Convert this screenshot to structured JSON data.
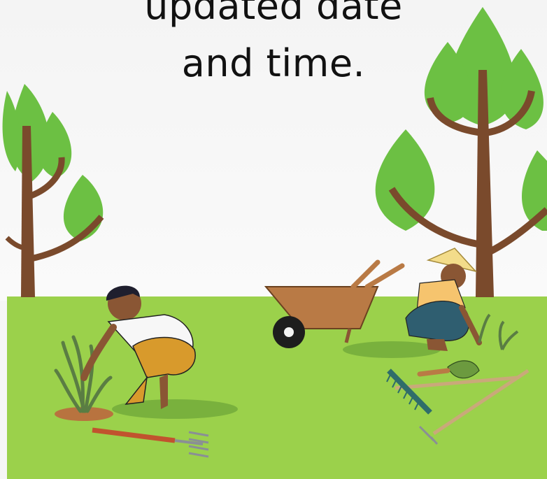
{
  "headline": {
    "line1": "updated date",
    "line2": "and time."
  },
  "colors": {
    "grass": "#9bd14b",
    "tree_leaf": "#6cc043",
    "tree_trunk": "#7a4a2c",
    "text": "#111111"
  },
  "icons": [
    "tree",
    "gardener",
    "wheelbarrow",
    "pitchfork",
    "rake",
    "trowel",
    "shrub"
  ]
}
